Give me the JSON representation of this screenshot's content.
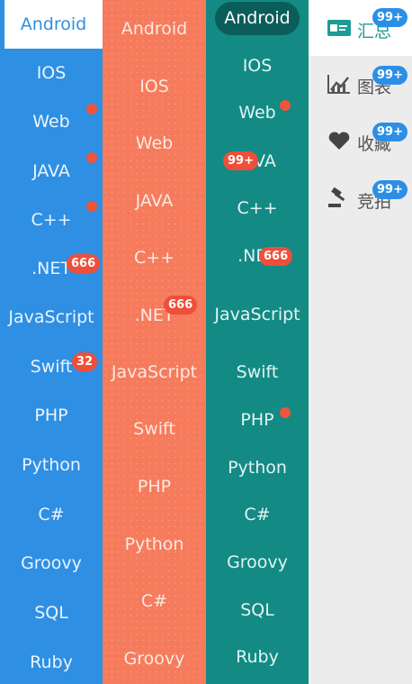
{
  "columns": {
    "blue": {
      "items": [
        "Android",
        "IOS",
        "Web",
        "JAVA",
        "C++",
        ".NET",
        "JavaScript",
        "Swift",
        "PHP",
        "Python",
        "C#",
        "Groovy",
        "SQL",
        "Ruby"
      ],
      "selected": "Android",
      "badges": {
        "net": "666",
        "swift": "32"
      }
    },
    "orange": {
      "items": [
        "Android",
        "IOS",
        "Web",
        "JAVA",
        "C++",
        ".NET",
        "JavaScript",
        "Swift",
        "PHP",
        "Python",
        "C#",
        "Groovy"
      ],
      "badges": {
        "net": "666"
      }
    },
    "teal": {
      "items": [
        "Android",
        "IOS",
        "Web",
        "JAVA",
        "C++",
        ".NET",
        "JavaScript",
        "Swift",
        "PHP",
        "Python",
        "C#",
        "Groovy",
        "SQL",
        "Ruby"
      ],
      "selected": "Android",
      "badges": {
        "java": "99+",
        "net": "666"
      }
    }
  },
  "tabs": [
    {
      "label": "汇总",
      "icon": "id-card-icon",
      "badge": "99+"
    },
    {
      "label": "图表",
      "icon": "chart-icon",
      "badge": "99+"
    },
    {
      "label": "收藏",
      "icon": "heart-icon",
      "badge": "99+"
    },
    {
      "label": "竞拍",
      "icon": "gavel-icon",
      "badge": "99+"
    }
  ],
  "colors": {
    "blue": "#2e8fe3",
    "orange": "#f57b5c",
    "teal": "#138a84",
    "badge_red": "#ef4f3a",
    "badge_blue": "#2c8fe6",
    "tab_selected": "#1c9c94"
  }
}
